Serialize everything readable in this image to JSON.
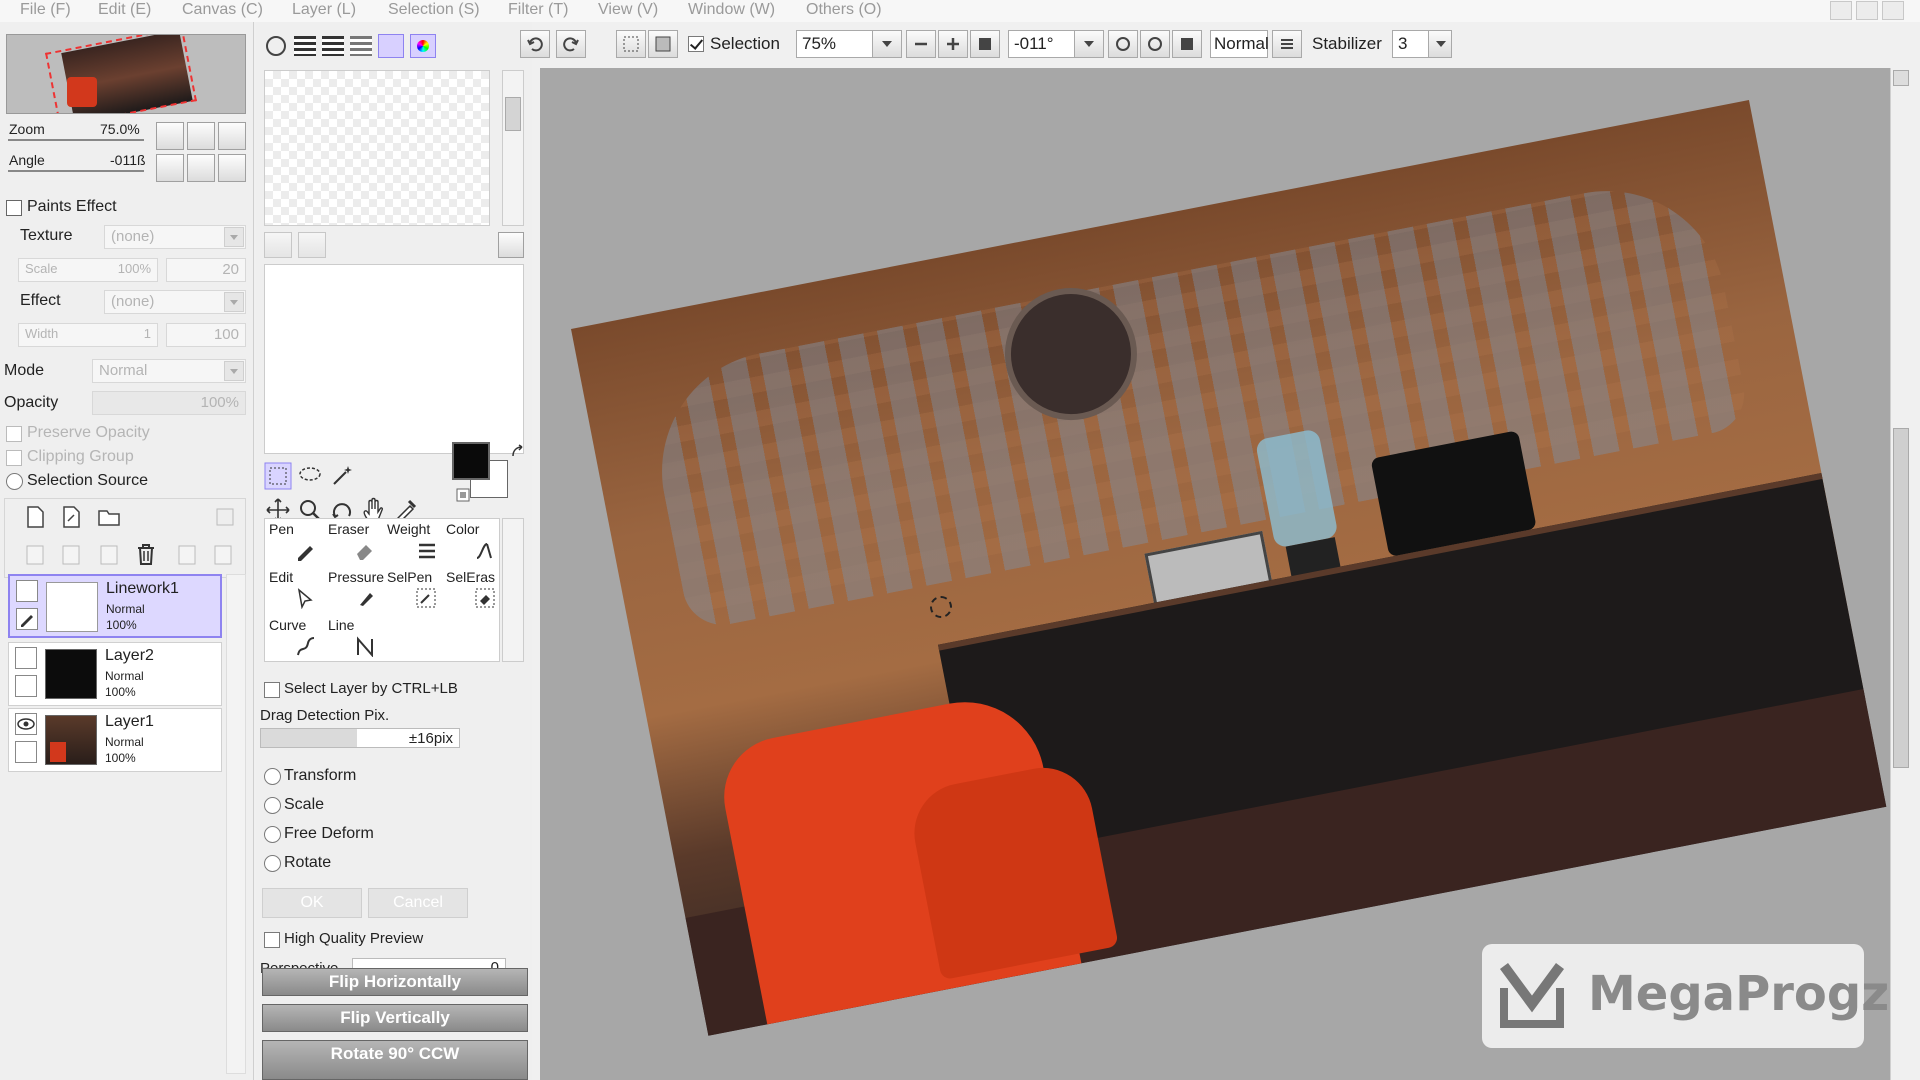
{
  "menu": [
    "File (F)",
    "Edit (E)",
    "Canvas (C)",
    "Layer (L)",
    "Selection (S)",
    "Filter (T)",
    "View (V)",
    "Window (W)",
    "Others (O)"
  ],
  "toolbar": {
    "selection_label": "Selection",
    "selection_checked": true,
    "zoom": "75%",
    "angle": "-011°",
    "blend_mode": "Normal",
    "stabilizer_label": "Stabilizer",
    "stabilizer_value": "3"
  },
  "navigator": {
    "zoom_label": "Zoom",
    "zoom_value": "75.0%",
    "angle_label": "Angle",
    "angle_value": "-011ß"
  },
  "paints_effect": {
    "header": "Paints Effect",
    "texture_label": "Texture",
    "texture_value": "(none)",
    "scale_label": "Scale",
    "scale_value": "100%",
    "scale_num": "20",
    "effect_label": "Effect",
    "effect_value": "(none)",
    "width_label": "Width",
    "width_value": "1",
    "width_num": "100"
  },
  "layer_props": {
    "mode_label": "Mode",
    "mode_value": "Normal",
    "opacity_label": "Opacity",
    "opacity_value": "100%",
    "preserve_opacity": "Preserve Opacity",
    "clipping_group": "Clipping Group",
    "selection_source": "Selection Source"
  },
  "layers": [
    {
      "name": "Linework1",
      "mode": "Normal",
      "opacity": "100%",
      "selected": true
    },
    {
      "name": "Layer2",
      "mode": "Normal",
      "opacity": "100%",
      "selected": false
    },
    {
      "name": "Layer1",
      "mode": "Normal",
      "opacity": "100%",
      "selected": false
    }
  ],
  "tools": {
    "row1": [
      "Pen",
      "Eraser",
      "Weight",
      "Color"
    ],
    "row2": [
      "Edit",
      "Pressure",
      "SelPen",
      "SelEras"
    ],
    "row3": [
      "Curve",
      "Line"
    ]
  },
  "transform_panel": {
    "select_layer": "Select Layer by CTRL+LB",
    "drag_detection_label": "Drag Detection Pix.",
    "drag_detection_value": "±16pix",
    "options": [
      "Transform",
      "Scale",
      "Free Deform",
      "Rotate"
    ],
    "ok_label": "OK",
    "cancel_label": "Cancel",
    "high_quality": "High Quality Preview",
    "perspective_label": "Perspective",
    "perspective_value": "0",
    "flip_h": "Flip Horizontally",
    "flip_v": "Flip Vertically",
    "rotate_ccw": "Rotate 90° CCW"
  },
  "watermark": {
    "text": "MegaProgz"
  },
  "colors": {
    "primary": "#0a0a0a",
    "secondary": "#ffffff",
    "selected_layer": "#ddd8ff",
    "canvas_bg": "#a7a7a7"
  }
}
